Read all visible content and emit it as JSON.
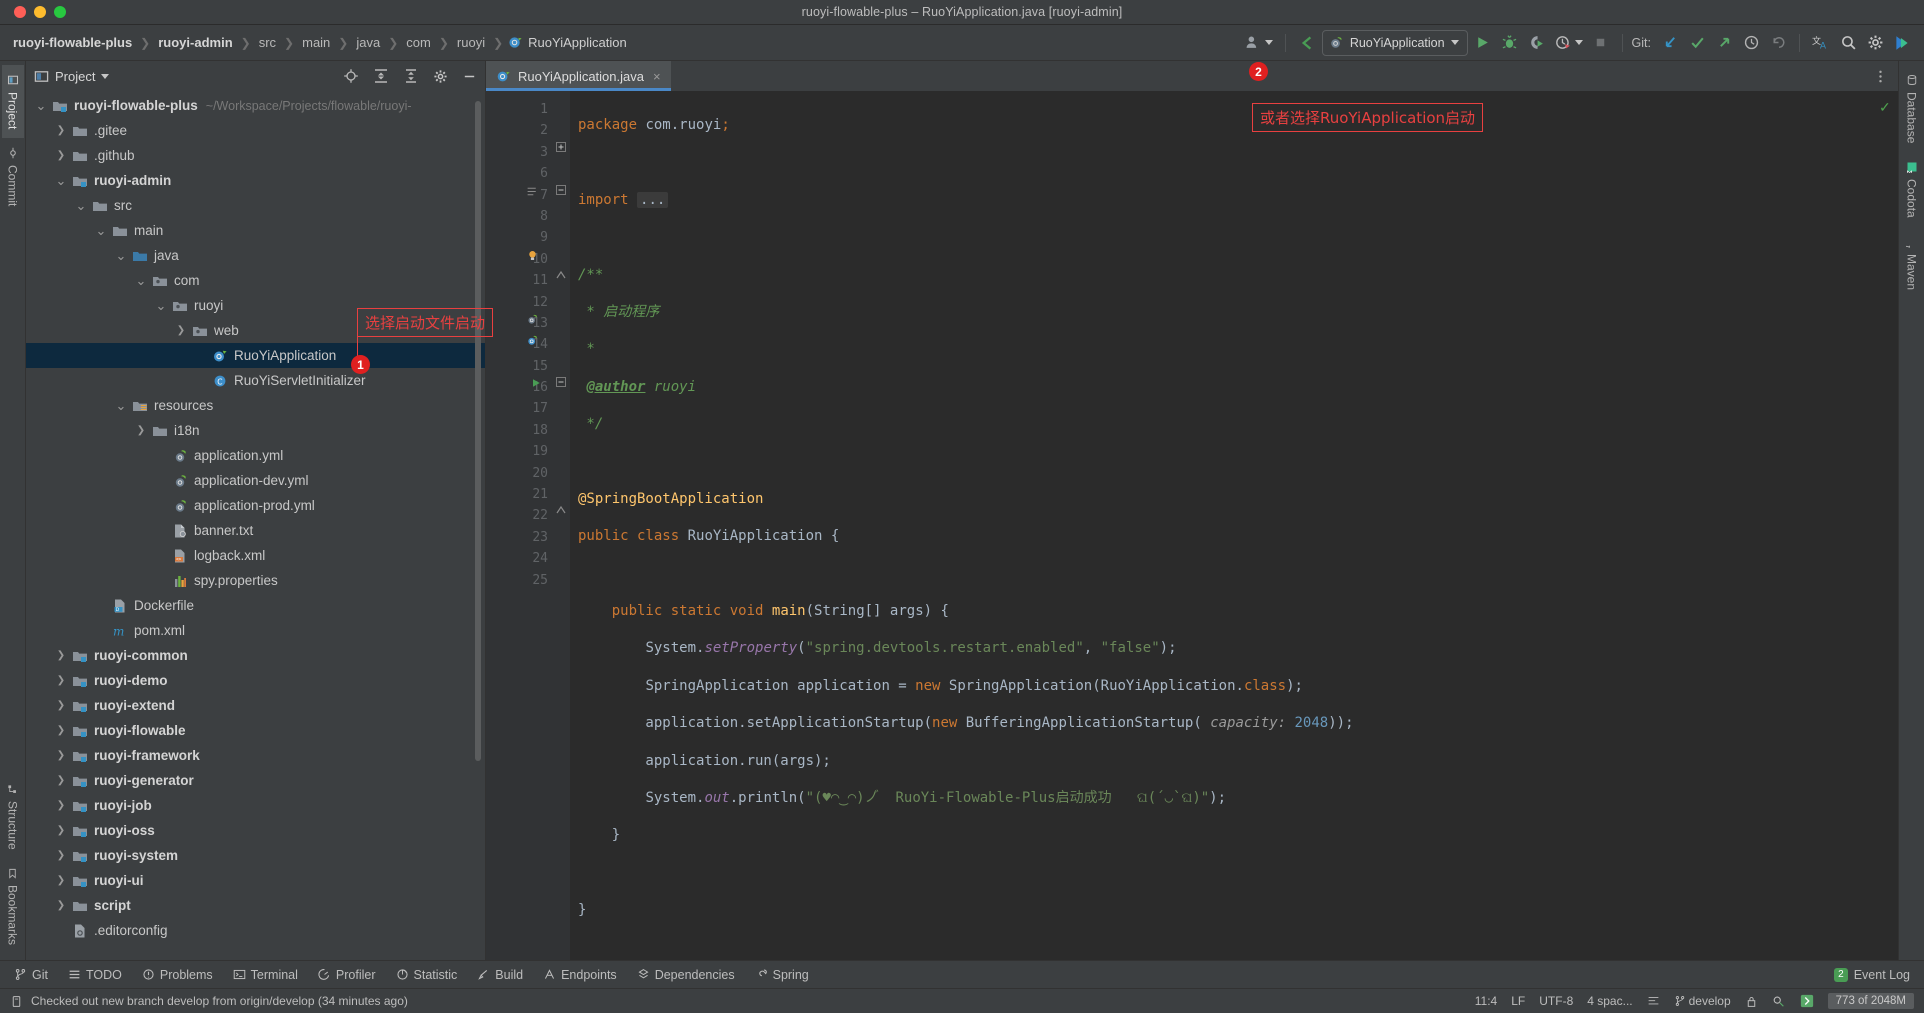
{
  "window": {
    "title": "ruoyi-flowable-plus – RuoYiApplication.java [ruoyi-admin]"
  },
  "breadcrumbs": [
    {
      "label": "ruoyi-flowable-plus",
      "bold": true
    },
    {
      "label": "ruoyi-admin",
      "bold": true
    },
    {
      "label": "src",
      "bold": false
    },
    {
      "label": "main",
      "bold": false
    },
    {
      "label": "java",
      "bold": false
    },
    {
      "label": "com",
      "bold": false
    },
    {
      "label": "ruoyi",
      "bold": false
    },
    {
      "label": "RuoYiApplication",
      "bold": false
    }
  ],
  "toolbar": {
    "run_config": "RuoYiApplication",
    "git_label": "Git:",
    "icons": {
      "user": "user-icon",
      "back_arrow": "back-arrow-icon",
      "run": "run-icon",
      "debug": "debug-icon",
      "run_coverage": "run-with-coverage-icon",
      "profiler": "profiler-icon",
      "stop": "stop-icon",
      "update": "git-update-icon",
      "commit": "git-commit-icon",
      "push": "git-push-icon",
      "history": "history-icon",
      "rollback": "rollback-icon",
      "translate": "translate-icon",
      "search": "search-icon",
      "settings": "gear-icon",
      "toolbox": "toolbox-icon"
    }
  },
  "left_rail": {
    "items": [
      "Project",
      "Commit",
      "Structure",
      "Bookmarks"
    ]
  },
  "right_rail": {
    "items": [
      "Database",
      "Codota",
      "Maven"
    ]
  },
  "project_panel": {
    "title": "Project",
    "header_icons": [
      "locate-icon",
      "expand-all-icon",
      "collapse-all-icon",
      "gear-icon",
      "hide-icon"
    ],
    "tree": [
      {
        "depth": 0,
        "twisty": "v",
        "icon": "module-folder",
        "label": "ruoyi-flowable-plus",
        "bold": true,
        "path": "~/Workspace/Projects/flowable/ruoyi-",
        "selected": false
      },
      {
        "depth": 1,
        "twisty": ">",
        "icon": "folder",
        "label": ".gitee",
        "bold": false,
        "path": "",
        "selected": false
      },
      {
        "depth": 1,
        "twisty": ">",
        "icon": "folder",
        "label": ".github",
        "bold": false,
        "path": "",
        "selected": false
      },
      {
        "depth": 1,
        "twisty": "v",
        "icon": "module-folder",
        "label": "ruoyi-admin",
        "bold": true,
        "path": "",
        "selected": false
      },
      {
        "depth": 2,
        "twisty": "v",
        "icon": "folder",
        "label": "src",
        "bold": false,
        "path": "",
        "selected": false
      },
      {
        "depth": 3,
        "twisty": "v",
        "icon": "folder",
        "label": "main",
        "bold": false,
        "path": "",
        "selected": false
      },
      {
        "depth": 4,
        "twisty": "v",
        "icon": "source-folder",
        "label": "java",
        "bold": false,
        "path": "",
        "selected": false
      },
      {
        "depth": 5,
        "twisty": "v",
        "icon": "package",
        "label": "com",
        "bold": false,
        "path": "",
        "selected": false
      },
      {
        "depth": 6,
        "twisty": "v",
        "icon": "package",
        "label": "ruoyi",
        "bold": false,
        "path": "",
        "selected": false
      },
      {
        "depth": 7,
        "twisty": ">",
        "icon": "package",
        "label": "web",
        "bold": false,
        "path": "",
        "selected": false
      },
      {
        "depth": 8,
        "twisty": "",
        "icon": "spring-class",
        "label": "RuoYiApplication",
        "bold": false,
        "path": "",
        "selected": true
      },
      {
        "depth": 8,
        "twisty": "",
        "icon": "java-class",
        "label": "RuoYiServletInitializer",
        "bold": false,
        "path": "",
        "selected": false
      },
      {
        "depth": 4,
        "twisty": "v",
        "icon": "resource-folder",
        "label": "resources",
        "bold": false,
        "path": "",
        "selected": false
      },
      {
        "depth": 5,
        "twisty": ">",
        "icon": "folder",
        "label": "i18n",
        "bold": false,
        "path": "",
        "selected": false
      },
      {
        "depth": 6,
        "twisty": "",
        "icon": "spring-yaml",
        "label": "application.yml",
        "bold": false,
        "path": "",
        "selected": false
      },
      {
        "depth": 6,
        "twisty": "",
        "icon": "spring-yaml",
        "label": "application-dev.yml",
        "bold": false,
        "path": "",
        "selected": false
      },
      {
        "depth": 6,
        "twisty": "",
        "icon": "spring-yaml",
        "label": "application-prod.yml",
        "bold": false,
        "path": "",
        "selected": false
      },
      {
        "depth": 6,
        "twisty": "",
        "icon": "txt-file",
        "label": "banner.txt",
        "bold": false,
        "path": "",
        "selected": false
      },
      {
        "depth": 6,
        "twisty": "",
        "icon": "xml-file",
        "label": "logback.xml",
        "bold": false,
        "path": "",
        "selected": false
      },
      {
        "depth": 6,
        "twisty": "",
        "icon": "properties-file",
        "label": "spy.properties",
        "bold": false,
        "path": "",
        "selected": false
      },
      {
        "depth": 3,
        "twisty": "",
        "icon": "docker-file",
        "label": "Dockerfile",
        "bold": false,
        "path": "",
        "selected": false
      },
      {
        "depth": 3,
        "twisty": "",
        "icon": "maven-file",
        "label": "pom.xml",
        "bold": false,
        "path": "",
        "selected": false
      },
      {
        "depth": 1,
        "twisty": ">",
        "icon": "module-folder",
        "label": "ruoyi-common",
        "bold": true,
        "path": "",
        "selected": false
      },
      {
        "depth": 1,
        "twisty": ">",
        "icon": "module-folder",
        "label": "ruoyi-demo",
        "bold": true,
        "path": "",
        "selected": false
      },
      {
        "depth": 1,
        "twisty": ">",
        "icon": "module-folder",
        "label": "ruoyi-extend",
        "bold": true,
        "path": "",
        "selected": false
      },
      {
        "depth": 1,
        "twisty": ">",
        "icon": "module-folder",
        "label": "ruoyi-flowable",
        "bold": true,
        "path": "",
        "selected": false
      },
      {
        "depth": 1,
        "twisty": ">",
        "icon": "module-folder",
        "label": "ruoyi-framework",
        "bold": true,
        "path": "",
        "selected": false
      },
      {
        "depth": 1,
        "twisty": ">",
        "icon": "module-folder",
        "label": "ruoyi-generator",
        "bold": true,
        "path": "",
        "selected": false
      },
      {
        "depth": 1,
        "twisty": ">",
        "icon": "module-folder",
        "label": "ruoyi-job",
        "bold": true,
        "path": "",
        "selected": false
      },
      {
        "depth": 1,
        "twisty": ">",
        "icon": "module-folder",
        "label": "ruoyi-oss",
        "bold": true,
        "path": "",
        "selected": false
      },
      {
        "depth": 1,
        "twisty": ">",
        "icon": "module-folder",
        "label": "ruoyi-system",
        "bold": true,
        "path": "",
        "selected": false
      },
      {
        "depth": 1,
        "twisty": ">",
        "icon": "module-folder",
        "label": "ruoyi-ui",
        "bold": true,
        "path": "",
        "selected": false
      },
      {
        "depth": 1,
        "twisty": ">",
        "icon": "folder",
        "label": "script",
        "bold": true,
        "path": "",
        "selected": false
      },
      {
        "depth": 1,
        "twisty": "",
        "icon": "config-file",
        "label": ".editorconfig",
        "bold": false,
        "path": "",
        "selected": false
      }
    ]
  },
  "editor": {
    "tab": {
      "label": "RuoYiApplication.java",
      "icon": "spring-class-icon",
      "close": "×"
    },
    "lines": [
      {
        "num": "1",
        "marker": "",
        "fold": "",
        "indent": 0
      },
      {
        "num": "2",
        "marker": "",
        "fold": "",
        "indent": 0
      },
      {
        "num": "3",
        "marker": "",
        "fold": "+",
        "indent": 0
      },
      {
        "num": "6",
        "marker": "",
        "fold": "",
        "indent": 0
      },
      {
        "num": "7",
        "marker": "doc",
        "fold": "-",
        "indent": 0
      },
      {
        "num": "8",
        "marker": "",
        "fold": "",
        "indent": 0
      },
      {
        "num": "9",
        "marker": "",
        "fold": "",
        "indent": 0
      },
      {
        "num": "10",
        "marker": "bulb",
        "fold": "",
        "indent": 0
      },
      {
        "num": "11",
        "marker": "",
        "fold": "c",
        "indent": 0
      },
      {
        "num": "12",
        "marker": "",
        "fold": "",
        "indent": 0
      },
      {
        "num": "13",
        "marker": "bean",
        "fold": "",
        "indent": 0
      },
      {
        "num": "14",
        "marker": "boot",
        "fold": "",
        "indent": 0
      },
      {
        "num": "15",
        "marker": "",
        "fold": "",
        "indent": 0
      },
      {
        "num": "16",
        "marker": "run",
        "fold": "-",
        "indent": 0
      },
      {
        "num": "17",
        "marker": "",
        "fold": "",
        "indent": 0
      },
      {
        "num": "18",
        "marker": "",
        "fold": "",
        "indent": 0
      },
      {
        "num": "19",
        "marker": "",
        "fold": "",
        "indent": 0
      },
      {
        "num": "20",
        "marker": "",
        "fold": "",
        "indent": 0
      },
      {
        "num": "21",
        "marker": "",
        "fold": "",
        "indent": 0
      },
      {
        "num": "22",
        "marker": "",
        "fold": "c",
        "indent": 0
      },
      {
        "num": "23",
        "marker": "",
        "fold": "",
        "indent": 0
      },
      {
        "num": "24",
        "marker": "",
        "fold": "",
        "indent": 0
      },
      {
        "num": "25",
        "marker": "",
        "fold": "",
        "indent": 0
      }
    ],
    "code_text": {
      "l1": "package com.ruoyi;",
      "l3": "import",
      "l3_fold": "...",
      "l7": "/**",
      "l8": " * 启动程序",
      "l9": " *",
      "l10_tag": "@author",
      "l10_rest": " ruoyi",
      "l11": " */",
      "l13": "@SpringBootApplication",
      "l14": "public class RuoYiApplication {",
      "l16": "    public static void main(String[] args) {",
      "l17_a": "        System.",
      "l17_b": "setProperty",
      "l17_c": "\"spring.devtools.restart.enabled\"",
      "l17_d": "\"false\"",
      "l18": "        SpringApplication application = new SpringApplication(RuoYiApplication.class);",
      "l19_a": "        application.setApplicationStartup(",
      "l19_kw": "new",
      "l19_b": " BufferingApplicationStartup(",
      "l19_param": "capacity:",
      "l19_num": "2048",
      "l19_c": "));",
      "l20": "        application.run(args);",
      "l21_a": "        System.",
      "l21_out": "out",
      "l21_b": ".println(",
      "l21_str": "\"(♥◠‿◠)ノ゙  RuoYi-Flowable-Plus启动成功   ଘ(੭ˊᵕˋ)੭\"",
      "l21_c": ");",
      "l22": "    }",
      "l24": "}"
    }
  },
  "annotations": [
    {
      "id": "1",
      "text": "选择启动文件启动",
      "badge": "1"
    },
    {
      "id": "2",
      "text": "或者选择RuoYiApplication启动",
      "badge": "2"
    }
  ],
  "tool_window_bar": {
    "items": [
      {
        "label": "Git",
        "icon": "git-branch-icon"
      },
      {
        "label": "TODO",
        "icon": "todo-icon"
      },
      {
        "label": "Problems",
        "icon": "problems-icon"
      },
      {
        "label": "Terminal",
        "icon": "terminal-icon"
      },
      {
        "label": "Profiler",
        "icon": "profiler-icon"
      },
      {
        "label": "Statistic",
        "icon": "statistic-icon"
      },
      {
        "label": "Build",
        "icon": "build-icon"
      },
      {
        "label": "Endpoints",
        "icon": "endpoints-icon"
      },
      {
        "label": "Dependencies",
        "icon": "dependencies-icon"
      },
      {
        "label": "Spring",
        "icon": "spring-icon"
      }
    ],
    "event_log": {
      "label": "Event Log",
      "count": "2"
    }
  },
  "status_bar": {
    "message": "Checked out new branch develop from origin/develop (34 minutes ago)",
    "caret": "11:4",
    "line_sep": "LF",
    "encoding": "UTF-8",
    "indent": "4 spac...",
    "branch": "develop",
    "memory": "773 of 2048M"
  },
  "colors": {
    "accent_blue": "#4a88c7",
    "selection": "#0d293e",
    "annotation_red": "#e84040",
    "badge_red": "#e02020",
    "run_green": "#499c54",
    "editor_bg": "#2b2b2b",
    "chrome_bg": "#3c3f41"
  }
}
